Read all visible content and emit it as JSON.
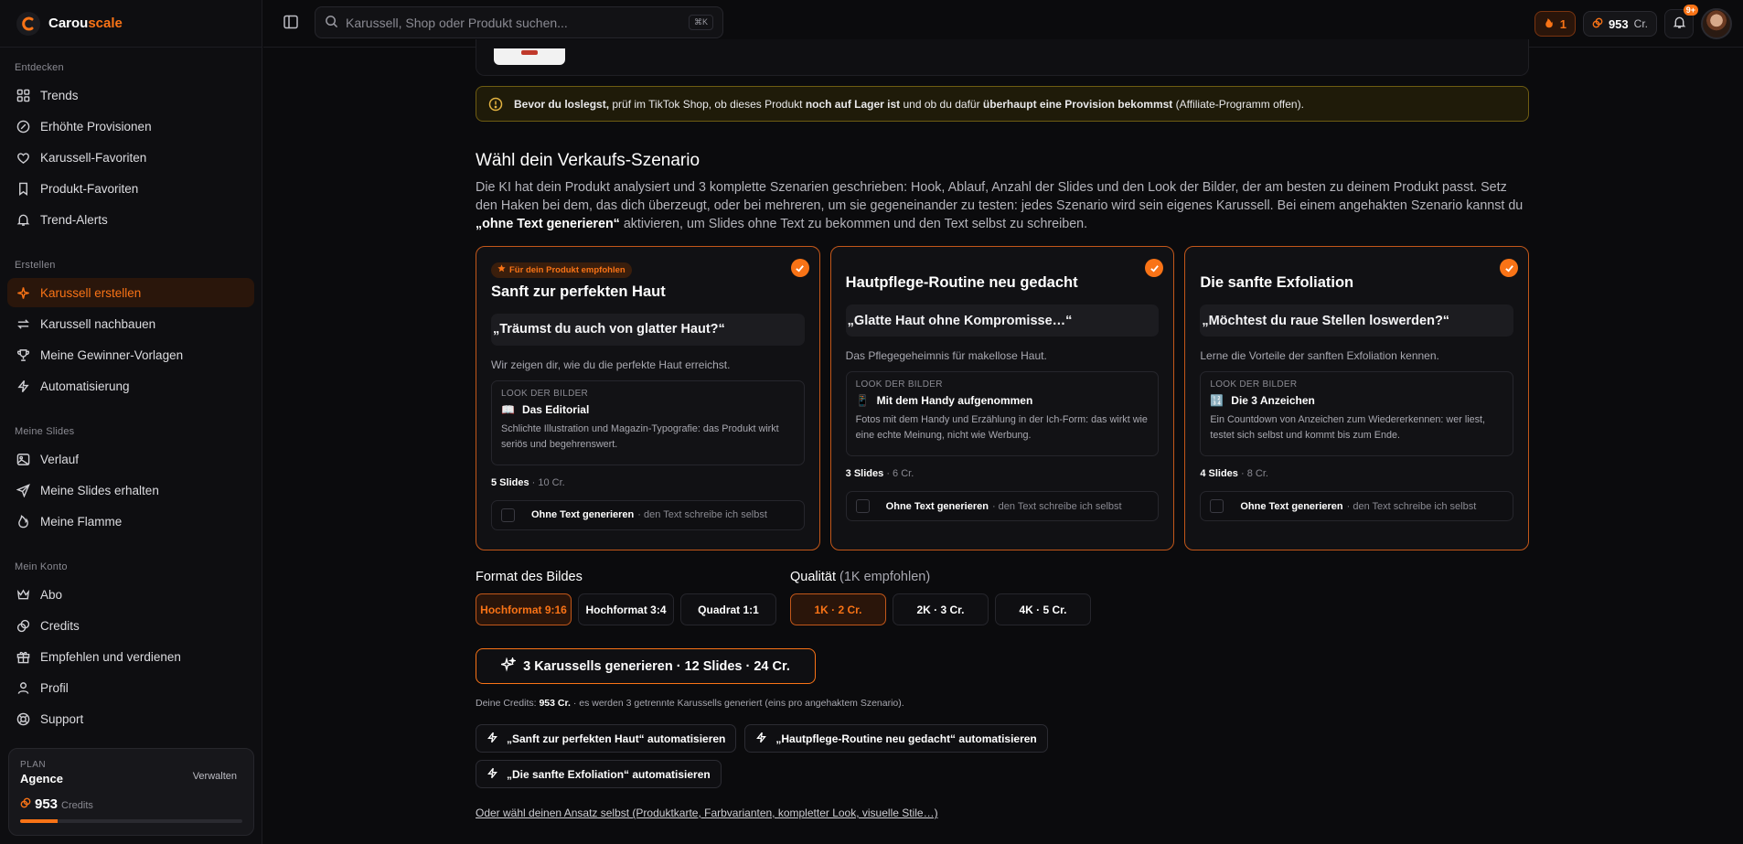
{
  "brand": {
    "name_part1": "Carou",
    "name_part2": "scale"
  },
  "sidebar": {
    "sections": [
      {
        "title": "Entdecken",
        "items": [
          {
            "label": "Trends",
            "icon": "grid-icon"
          },
          {
            "label": "Erhöhte Provisionen",
            "icon": "percent-badge-icon"
          },
          {
            "label": "Karussell-Favoriten",
            "icon": "heart-icon"
          },
          {
            "label": "Produkt-Favoriten",
            "icon": "bookmark-icon"
          },
          {
            "label": "Trend-Alerts",
            "icon": "bell-icon"
          }
        ]
      },
      {
        "title": "Erstellen",
        "items": [
          {
            "label": "Karussell erstellen",
            "icon": "sparkle-icon",
            "active": true
          },
          {
            "label": "Karussell nachbauen",
            "icon": "repeat-icon"
          },
          {
            "label": "Meine Gewinner-Vorlagen",
            "icon": "trophy-icon"
          },
          {
            "label": "Automatisierung",
            "icon": "lightning-icon"
          }
        ]
      },
      {
        "title": "Meine Slides",
        "items": [
          {
            "label": "Verlauf",
            "icon": "image-icon"
          },
          {
            "label": "Meine Slides erhalten",
            "icon": "send-icon"
          },
          {
            "label": "Meine Flamme",
            "icon": "flame-icon"
          }
        ]
      },
      {
        "title": "Mein Konto",
        "items": [
          {
            "label": "Abo",
            "icon": "crown-icon"
          },
          {
            "label": "Credits",
            "icon": "coins-icon"
          },
          {
            "label": "Empfehlen und verdienen",
            "icon": "gift-icon"
          },
          {
            "label": "Profil",
            "icon": "user-icon"
          },
          {
            "label": "Support",
            "icon": "lifebuoy-icon"
          }
        ]
      }
    ],
    "plan": {
      "label": "PLAN",
      "name": "Agence",
      "manage": "Verwalten",
      "credits": "953",
      "credits_label": "Credits",
      "bar_fraction": 0.17
    }
  },
  "topbar": {
    "search_placeholder": "Karussell, Shop oder Produkt suchen...",
    "shortcut": "⌘K",
    "streak": "1",
    "credits": "953",
    "credits_unit": "Cr.",
    "notif_badge": "9+"
  },
  "warning": {
    "b1": "Bevor du loslegst,",
    "t1": " prüf im TikTok Shop, ob dieses Produkt ",
    "b2": "noch auf Lager ist",
    "t2": " und ob du dafür ",
    "b3": "überhaupt eine Provision bekommst",
    "t3": " (Affiliate-Programm offen)."
  },
  "scenario": {
    "heading": "Wähl dein Verkaufs-Szenario",
    "intro_1": "Die KI hat dein Produkt analysiert und 3 komplette Szenarien geschrieben: Hook, Ablauf, Anzahl der Slides und den Look der Bilder, der am besten zu deinem Produkt passt. Setz den Haken bei dem, das dich überzeugt, oder bei mehreren, um sie gegeneinander zu testen: jedes Szenario wird sein eigenes Karussell. Bei einem angehakten Szenario kannst du ",
    "intro_bold": "„ohne Text generieren“",
    "intro_2": " aktivieren, um Slides ohne Text zu bekommen und den Text selbst zu schreiben.",
    "recommended_badge": "Für dein Produkt empfohlen",
    "look_label": "LOOK DER BILDER",
    "notext_bold": "Ohne Text generieren",
    "notext_rest": "· den Text schreibe ich selbst",
    "cards": [
      {
        "title": "Sanft zur perfekten Haut",
        "hook": "„Träumst du auch von glatter Haut?“",
        "desc": "Wir zeigen dir, wie du die perfekte Haut erreichst.",
        "look_icon": "📖",
        "look_name": "Das Editorial",
        "look_desc": "Schlichte Illustration und Magazin-Typografie: das Produkt wirkt seriös und begehrenswert.",
        "slides": "5 Slides",
        "cost": "· 10 Cr."
      },
      {
        "title": "Hautpflege-Routine neu gedacht",
        "hook": "„Glatte Haut ohne Kompromisse…“",
        "desc": "Das Pflegegeheimnis für makellose Haut.",
        "look_icon": "📱",
        "look_name": "Mit dem Handy aufgenommen",
        "look_desc": "Fotos mit dem Handy und Erzählung in der Ich-Form: das wirkt wie eine echte Meinung, nicht wie Werbung.",
        "slides": "3 Slides",
        "cost": "· 6 Cr."
      },
      {
        "title": "Die sanfte Exfoliation",
        "hook": "„Möchtest du raue Stellen loswerden?“",
        "desc": "Lerne die Vorteile der sanften Exfoliation kennen.",
        "look_icon": "🔢",
        "look_name": "Die 3 Anzeichen",
        "look_desc": "Ein Countdown von Anzeichen zum Wiedererkennen: wer liest, testet sich selbst und kommt bis zum Ende.",
        "slides": "4 Slides",
        "cost": "· 8 Cr."
      }
    ]
  },
  "format": {
    "label": "Format des Bildes",
    "options": [
      "Hochformat 9:16",
      "Hochformat 3:4",
      "Quadrat 1:1"
    ]
  },
  "quality": {
    "label": "Qualität",
    "hint": "(1K empfohlen)",
    "options": [
      "1K · 2 Cr.",
      "2K · 3 Cr.",
      "4K · 5 Cr."
    ]
  },
  "generate": {
    "label": "3 Karussells generieren · 12 Slides · 24 Cr.",
    "note_prefix": "Deine Credits: ",
    "note_credits": "953 Cr.",
    "note_suffix": " · es werden 3 getrennte Karussells generiert (eins pro angehaktem Szenario)."
  },
  "automate": [
    "„Sanft zur perfekten Haut“ automatisieren",
    "„Hautpflege-Routine neu gedacht“ automatisieren",
    "„Die sanfte Exfoliation“ automatisieren"
  ],
  "own_link": "Oder wähl deinen Ansatz selbst (Produktkarte, Farbvarianten, kompletter Look, visuelle Stile…)",
  "colors": {
    "accent": "#f97316",
    "warning_border": "#6e5c12",
    "background": "#0b0b0d"
  }
}
